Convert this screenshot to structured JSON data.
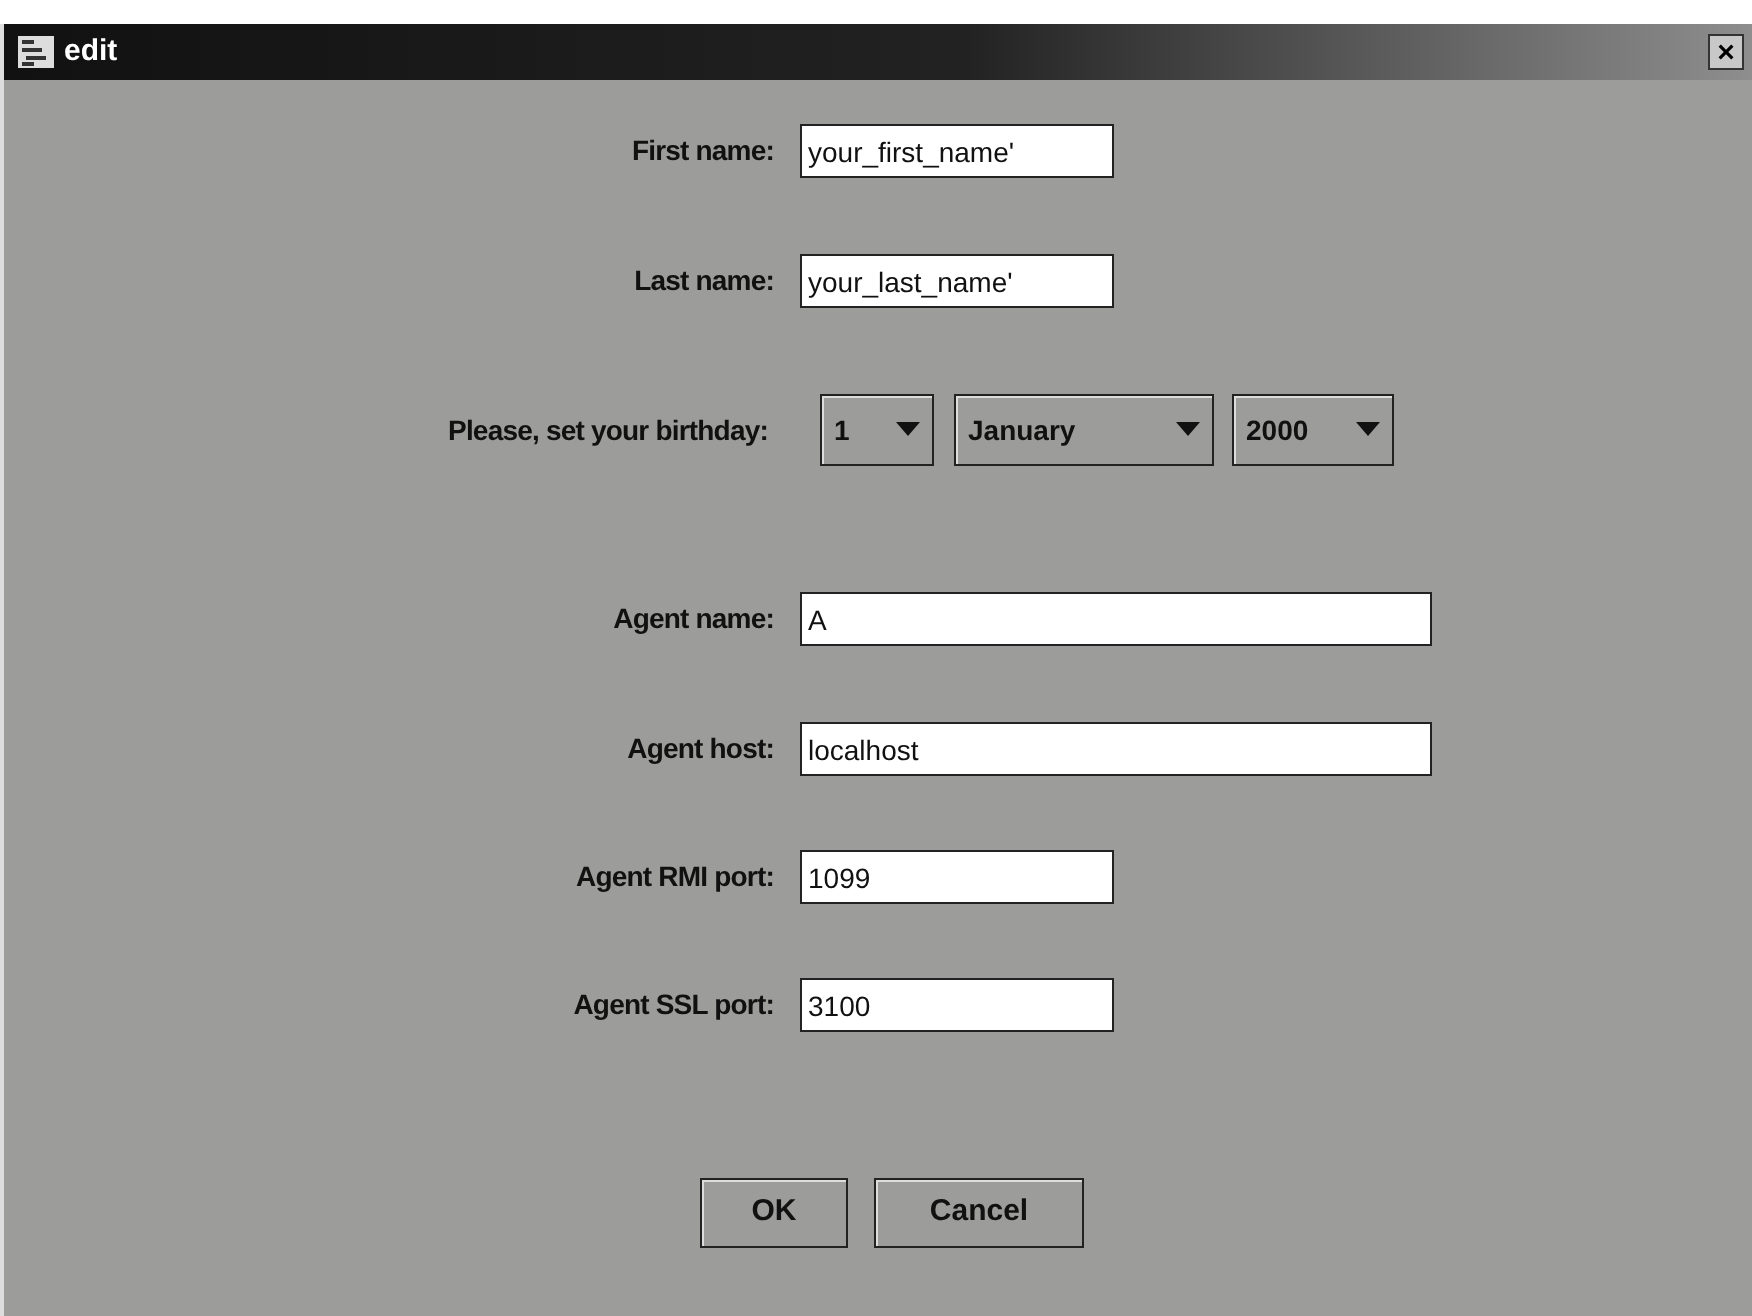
{
  "window": {
    "title": "edit",
    "close": "×"
  },
  "fields": [
    {
      "kind": "text",
      "label": "First name:",
      "value": "your_first_name'"
    },
    {
      "kind": "text",
      "label": "Last name:",
      "value": "your_last_name'"
    },
    {
      "kind": "date",
      "label": "Please, set your birthday:",
      "day": "1",
      "month": "January",
      "year": "2000"
    },
    {
      "kind": "text",
      "label": "Agent name:",
      "value": "A"
    },
    {
      "kind": "text",
      "label": "Agent host:",
      "value": "localhost"
    },
    {
      "kind": "text",
      "label": "Agent RMI port:",
      "value": "1099"
    },
    {
      "kind": "text",
      "label": "Agent SSL port:",
      "value": "3100"
    }
  ],
  "buttons": [
    "OK",
    "Cancel"
  ]
}
